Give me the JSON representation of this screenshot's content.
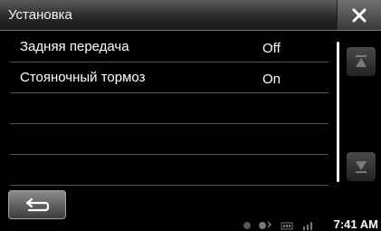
{
  "header": {
    "title": "Установка"
  },
  "settings": {
    "items": [
      {
        "label": "Задняя передача",
        "value": "Off"
      },
      {
        "label": "Стояночный тормоз",
        "value": "On"
      }
    ]
  },
  "status": {
    "time": "7:41 AM",
    "icons": [
      "gps-icon",
      "bluetooth-icon",
      "battery-icon",
      "signal-icon"
    ]
  },
  "icons": {
    "close": "close-icon",
    "scroll_up": "arrow-up-icon",
    "scroll_down": "arrow-down-icon",
    "back": "back-arrow-icon"
  }
}
